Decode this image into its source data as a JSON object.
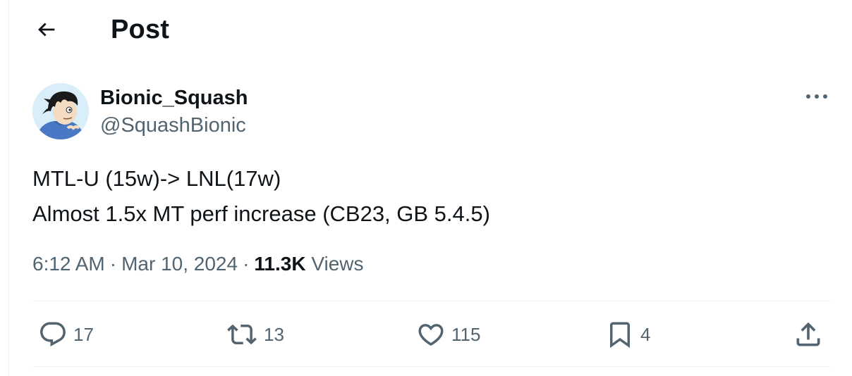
{
  "header": {
    "title": "Post"
  },
  "author": {
    "name": "Bionic_Squash",
    "handle": "@SquashBionic"
  },
  "tweet": {
    "text": "MTL-U (15w)-> LNL(17w)\nAlmost 1.5x MT perf increase (CB23, GB 5.4.5)"
  },
  "meta": {
    "time": "6:12 AM",
    "date": "Mar 10, 2024",
    "separator": "·",
    "views_count": "11.3K",
    "views_label": "Views"
  },
  "actions": {
    "reply": {
      "icon": "reply-icon",
      "count": "17"
    },
    "repost": {
      "icon": "repost-icon",
      "count": "13"
    },
    "like": {
      "icon": "heart-icon",
      "count": "115"
    },
    "bookmark": {
      "icon": "bookmark-icon",
      "count": "4"
    },
    "share": {
      "icon": "share-icon"
    }
  },
  "colors": {
    "text": "#0f1419",
    "secondary": "#536471",
    "border": "#eff3f4"
  }
}
